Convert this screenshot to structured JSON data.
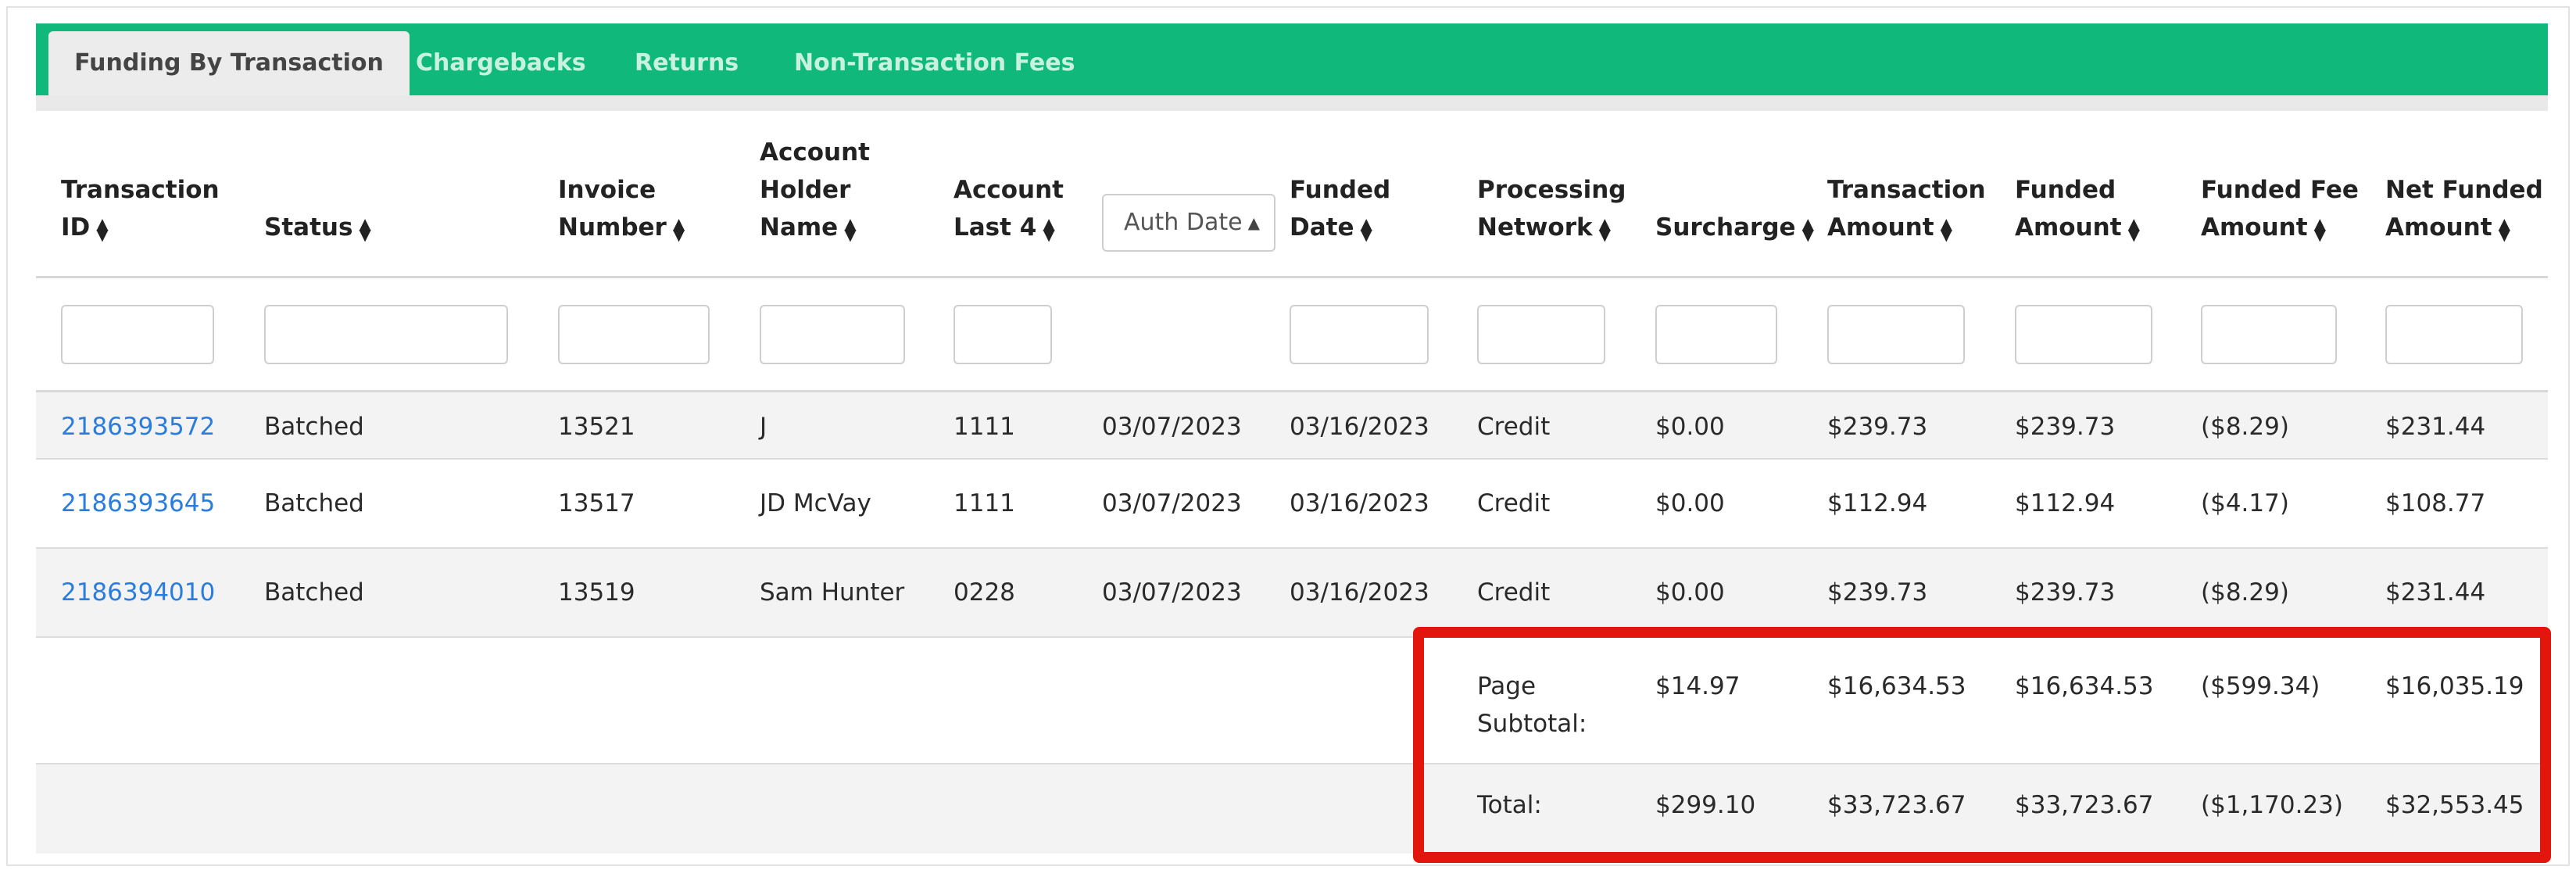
{
  "tabs": [
    {
      "label": "Funding By Transaction",
      "active": true
    },
    {
      "label": "Chargebacks",
      "active": false
    },
    {
      "label": "Returns",
      "active": false
    },
    {
      "label": "Non-Transaction Fees",
      "active": false
    }
  ],
  "columns": {
    "transaction_id": {
      "line1": "Transaction",
      "line2": "ID"
    },
    "status": {
      "line1": "Status"
    },
    "invoice_number": {
      "line1": "Invoice",
      "line2": "Number"
    },
    "account_holder_name": {
      "line1": "Account",
      "line2": "Holder",
      "line3": "Name"
    },
    "account_last4": {
      "line1": "Account",
      "line2": "Last 4"
    },
    "auth_date_select": "Auth Date",
    "funded_date": {
      "line1": "Funded",
      "line2": "Date"
    },
    "processing_network": {
      "line1": "Processing",
      "line2": "Network"
    },
    "surcharge": {
      "line1": "Surcharge"
    },
    "transaction_amount": {
      "line1": "Transaction",
      "line2": "Amount"
    },
    "funded_amount": {
      "line1": "Funded",
      "line2": "Amount"
    },
    "funded_fee_amount": {
      "line1": "Funded Fee",
      "line2": "Amount"
    },
    "net_funded_amount": {
      "line1": "Net Funded",
      "line2": "Amount"
    }
  },
  "rows": [
    {
      "transaction_id": "2186393572",
      "status": "Batched",
      "invoice": "13521",
      "holder": "J",
      "last4": "1111",
      "auth_date": "03/07/2023",
      "funded_date": "03/16/2023",
      "network": "Credit",
      "surcharge": "$0.00",
      "txn_amount": "$239.73",
      "funded_amount": "$239.73",
      "fee": "($8.29)",
      "net": "$231.44"
    },
    {
      "transaction_id": "2186393645",
      "status": "Batched",
      "invoice": "13517",
      "holder": "JD McVay",
      "last4": "1111",
      "auth_date": "03/07/2023",
      "funded_date": "03/16/2023",
      "network": "Credit",
      "surcharge": "$0.00",
      "txn_amount": "$112.94",
      "funded_amount": "$112.94",
      "fee": "($4.17)",
      "net": "$108.77"
    },
    {
      "transaction_id": "2186394010",
      "status": "Batched",
      "invoice": "13519",
      "holder": "Sam Hunter",
      "last4": "0228",
      "auth_date": "03/07/2023",
      "funded_date": "03/16/2023",
      "network": "Credit",
      "surcharge": "$0.00",
      "txn_amount": "$239.73",
      "funded_amount": "$239.73",
      "fee": "($8.29)",
      "net": "$231.44"
    }
  ],
  "page_subtotal": {
    "label_line1": "Page",
    "label_line2": "Subtotal:",
    "surcharge": "$14.97",
    "txn_amount": "$16,634.53",
    "funded_amount": "$16,634.53",
    "fee": "($599.34)",
    "net": "$16,035.19"
  },
  "total": {
    "label": "Total:",
    "surcharge": "$299.10",
    "txn_amount": "$33,723.67",
    "funded_amount": "$33,723.67",
    "fee": "($1,170.23)",
    "net": "$32,553.45"
  },
  "colors": {
    "tab_bar": "#10b97b",
    "link": "#2a7ddc",
    "highlight": "#e3160e"
  }
}
